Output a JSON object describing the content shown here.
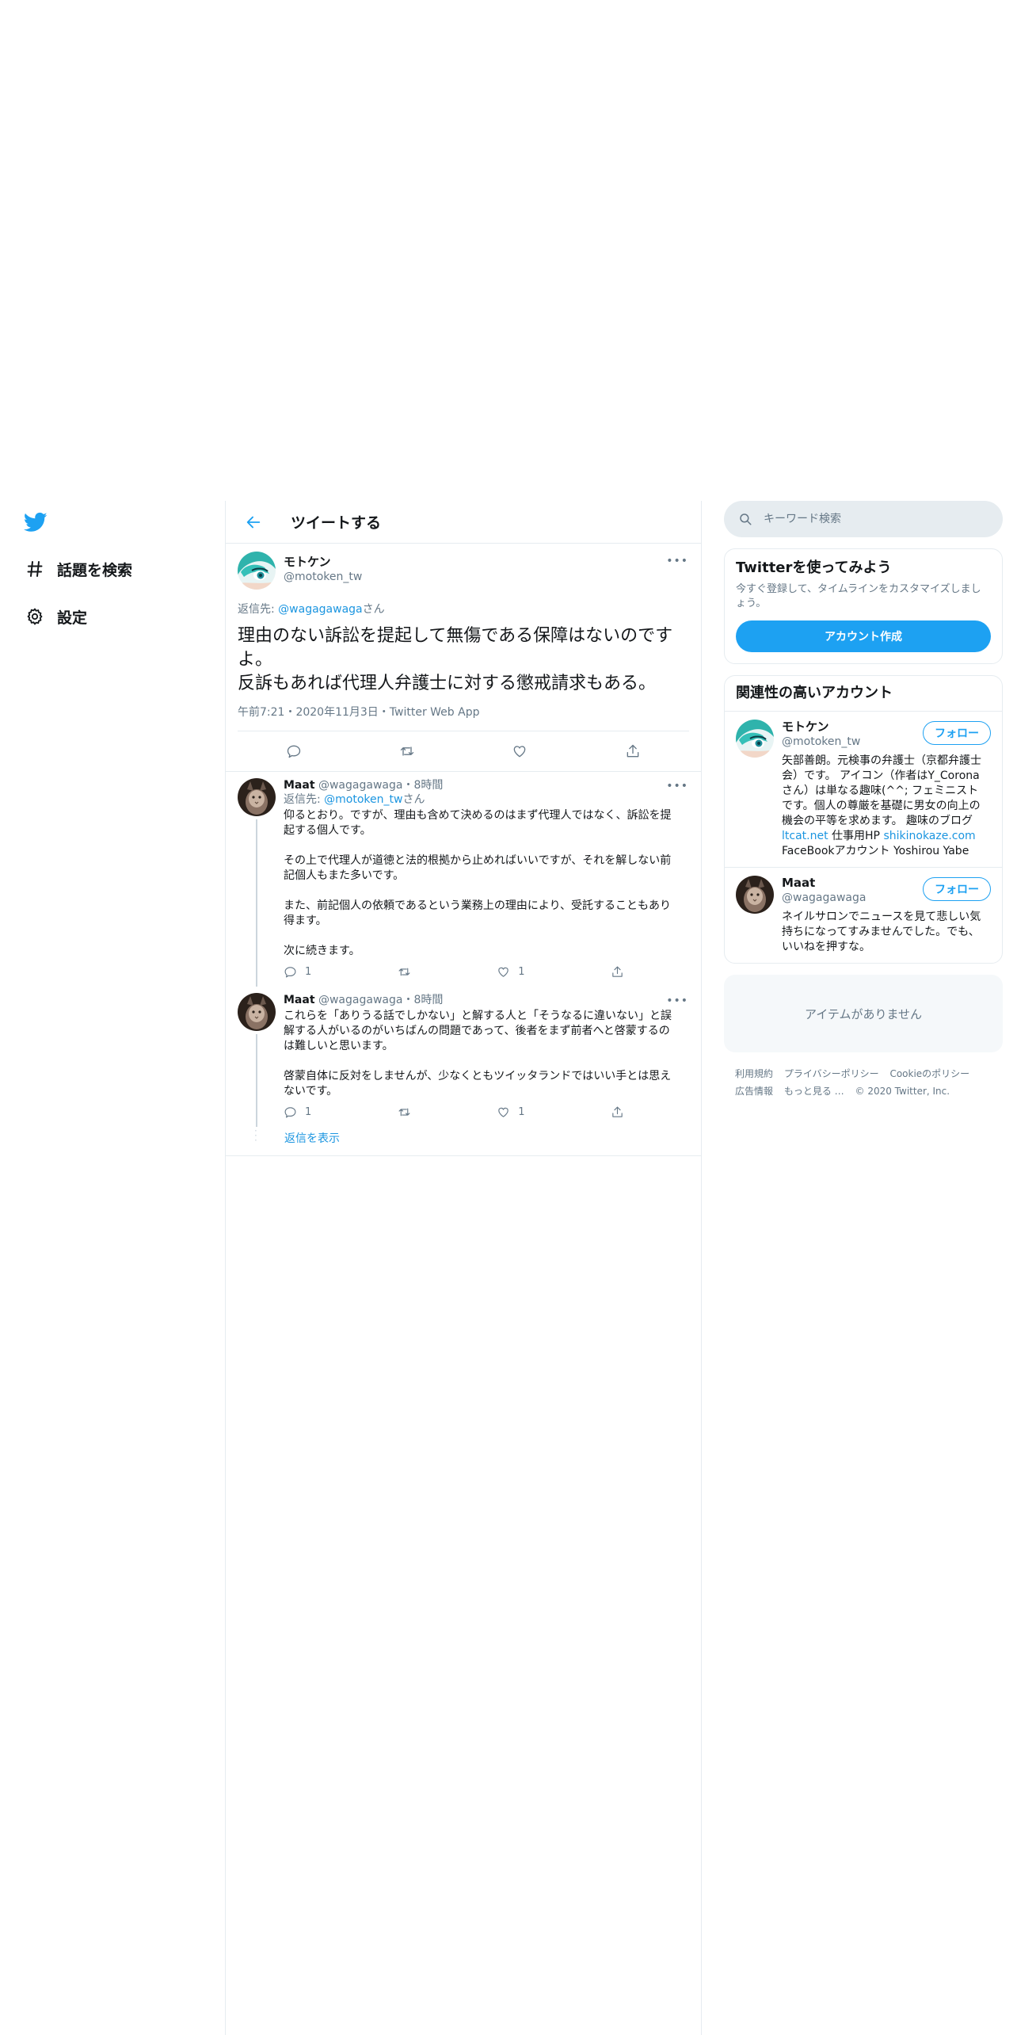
{
  "nav": {
    "items": [
      {
        "label": "話題を検索",
        "icon": "hashtag-icon"
      },
      {
        "label": "設定",
        "icon": "gear-icon"
      }
    ]
  },
  "header": {
    "title": "ツイートする"
  },
  "focus_tweet": {
    "name": "モトケン",
    "handle": "@motoken_tw",
    "reply_prefix": "返信先: ",
    "reply_handle": "@wagagawaga",
    "reply_suffix": "さん",
    "text": "理由のない訴訟を提起して無傷である保障はないのですよ。\n反訴もあれば代理人弁護士に対する懲戒請求もある。",
    "meta": "午前7:21・2020年11月3日・Twitter Web App"
  },
  "replies": [
    {
      "name": "Maat",
      "handle": "@wagagawaga",
      "time": "・8時間",
      "reply_prefix": "返信先: ",
      "reply_handle": "@motoken_tw",
      "reply_suffix": "さん",
      "text": "仰るとおり。ですが、理由も含めて決めるのはまず代理人ではなく、訴訟を提起する個人です。\n\nその上で代理人が道徳と法的根拠から止めればいいですが、それを解しない前記個人もまた多いです。\n\nまた、前記個人の依頼であるという業務上の理由により、受託することもあり得ます。\n\n次に続きます。",
      "reply_count": "1",
      "like_count": "1"
    },
    {
      "name": "Maat",
      "handle": "@wagagawaga",
      "time": "・8時間",
      "text": "これらを「ありうる話でしかない」と解する人と「そうなるに違いない」と誤解する人がいるのがいちばんの問題であって、後者をまず前者へと啓蒙するのは難しいと思います。\n\n啓蒙自体に反対をしませんが、少なくともツイッタランドではいい手とは思えないです。",
      "reply_count": "1",
      "like_count": "1"
    }
  ],
  "show_replies": "返信を表示",
  "search": {
    "placeholder": "キーワード検索"
  },
  "signup": {
    "title": "Twitterを使ってみよう",
    "desc": "今すぐ登録して、タイムラインをカスタマイズしましょう。",
    "button": "アカウント作成"
  },
  "related": {
    "title": "関連性の高いアカウント",
    "accounts": [
      {
        "name": "モトケン",
        "handle": "@motoken_tw",
        "follow": "フォロー",
        "bio_1": "矢部善朗。元検事の弁護士（京都弁護士会）です。 アイコン（作者はY_Coronaさん）は単なる趣味(^^; フェミニストです。個人の尊厳を基礎に男女の向上の機会の平等を求めます。 趣味のブログ ",
        "link_1": "ltcat.net",
        "bio_2": " 仕事用HP ",
        "link_2": "shikinokaze.com",
        "bio_3": " FaceBookアカウント Yoshirou Yabe"
      },
      {
        "name": "Maat",
        "handle": "@wagagawaga",
        "follow": "フォロー",
        "bio": "ネイルサロンでニュースを見て悲しい気持ちになってすみませんでした。でも、いいねを押すな。"
      }
    ]
  },
  "empty_text": "アイテムがありません",
  "footer": {
    "links": [
      "利用規約",
      "プライバシーポリシー",
      "Cookieのポリシー",
      "広告情報",
      "もっと見る …",
      "© 2020 Twitter, Inc."
    ]
  },
  "colors": {
    "accent": "#1da1f2",
    "link": "#1b95e0",
    "muted": "#657786",
    "border": "#e6ecf0"
  }
}
